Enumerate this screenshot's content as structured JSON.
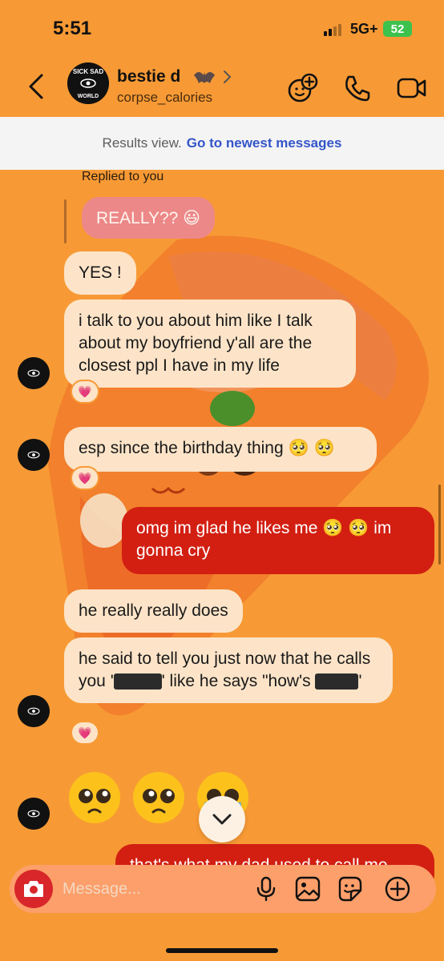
{
  "status_bar": {
    "time": "5:51",
    "network": "5G+",
    "battery": "52"
  },
  "header": {
    "name": "bestie d",
    "username": "corpse_calories"
  },
  "banner": {
    "text": "Results view.",
    "link": "Go to newest messages"
  },
  "messages": {
    "replied_label": "Replied to you",
    "quoted_text": "REALLY?? 😃",
    "m1": "YES !",
    "m2": "i talk to you about him like I talk about my boyfriend y'all are the closest ppl I have in my life",
    "m3": "esp since the birthday thing",
    "m4a": "omg im glad he likes me",
    "m4b": "im gonna cry",
    "m5": "he really really does",
    "m6a": "he said to tell you just now that he calls you '",
    "m6b": "' like he says \"how's",
    "m6c": "'",
    "m7_partial": "that's what my dad used to call me",
    "reaction": "💗"
  },
  "composer": {
    "placeholder": "Message..."
  },
  "avatar_text": {
    "top": "SICK SAD",
    "bottom": "WORLD"
  },
  "colors": {
    "background": "#f79a35",
    "incoming": "#fde4c8",
    "outgoing": "#d21f12",
    "link": "#3455c9"
  }
}
